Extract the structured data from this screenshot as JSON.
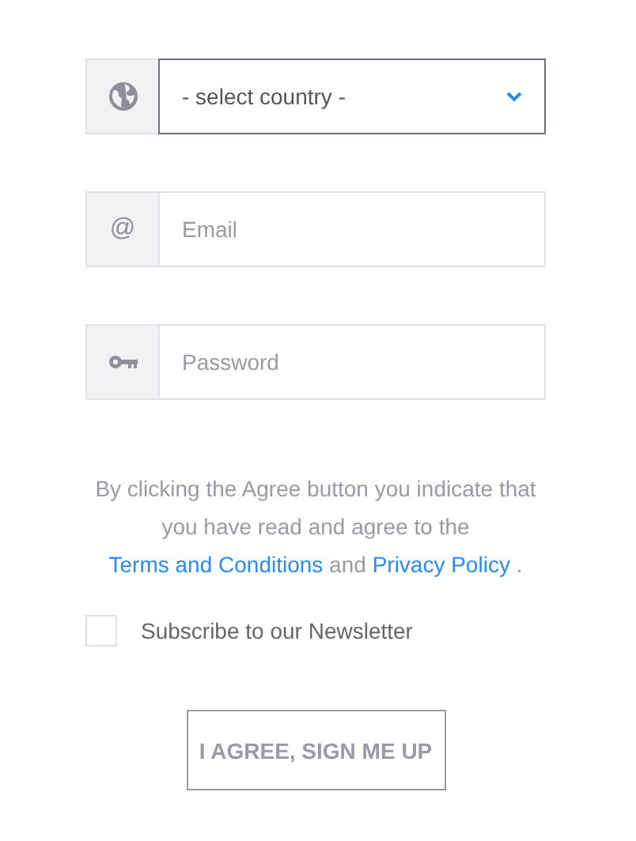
{
  "fields": [
    {
      "kind": "select",
      "value": "- select country -",
      "focused": true
    },
    {
      "kind": "email",
      "icon_text": "@",
      "placeholder": "Email",
      "focused": false
    },
    {
      "kind": "password",
      "placeholder": "Password",
      "focused": false
    }
  ],
  "consent": {
    "before": "By clicking the Agree button you indicate that you have read and agree to the",
    "terms_link": "Terms and Conditions",
    "between": "and",
    "privacy_link": "Privacy Policy",
    "after": "."
  },
  "newsletter": {
    "label": "Subscribe to our Newsletter",
    "checked": false
  },
  "submit": {
    "label": "I AGREE, SIGN ME UP"
  }
}
